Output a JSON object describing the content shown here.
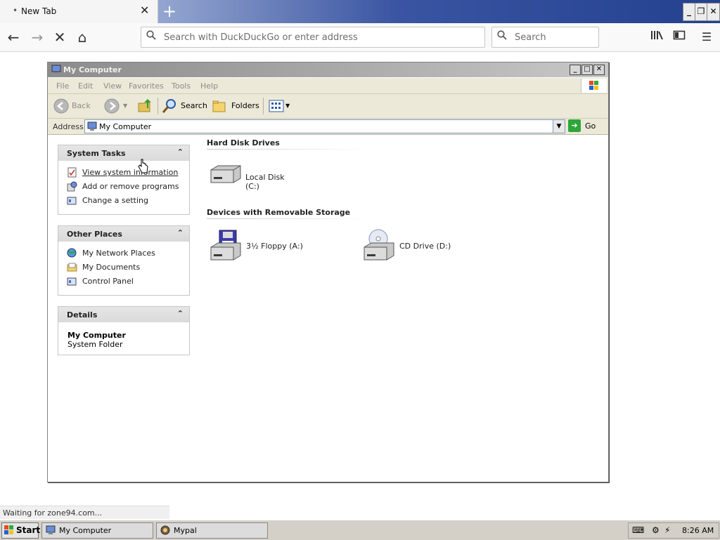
{
  "browser": {
    "tab_title": "New Tab",
    "new_tab_symbol": "+",
    "url_placeholder": "Search with DuckDuckGo or enter address",
    "search_placeholder": "Search",
    "status_text": "Waiting for zone94.com..."
  },
  "window": {
    "title": "My Computer",
    "menu": [
      "File",
      "Edit",
      "View",
      "Favorites",
      "Tools",
      "Help"
    ],
    "toolbar": {
      "back": "Back",
      "search": "Search",
      "folders": "Folders"
    },
    "address_label": "Address",
    "address_value": "My Computer",
    "go_label": "Go"
  },
  "left_panes": {
    "system_tasks": {
      "title": "System Tasks",
      "items": [
        "View system information",
        "Add or remove programs",
        "Change a setting"
      ]
    },
    "other_places": {
      "title": "Other Places",
      "items": [
        "My Network Places",
        "My Documents",
        "Control Panel"
      ]
    },
    "details": {
      "title": "Details",
      "name": "My Computer",
      "type": "System Folder"
    }
  },
  "main": {
    "hard_disk_title": "Hard Disk Drives",
    "hard_disks": [
      "Local Disk (C:)"
    ],
    "removable_title": "Devices with Removable Storage",
    "removable": [
      "3½ Floppy (A:)",
      "CD Drive (D:)"
    ]
  },
  "taskbar": {
    "start": "Start",
    "buttons": [
      "My Computer",
      "Mypal"
    ],
    "clock": "8:26 AM"
  },
  "colors": {
    "title_bar_gradient_start": "#8c8c8c",
    "menu_background": "#ece9d8",
    "taskbar_background": "#d4d0c8"
  }
}
